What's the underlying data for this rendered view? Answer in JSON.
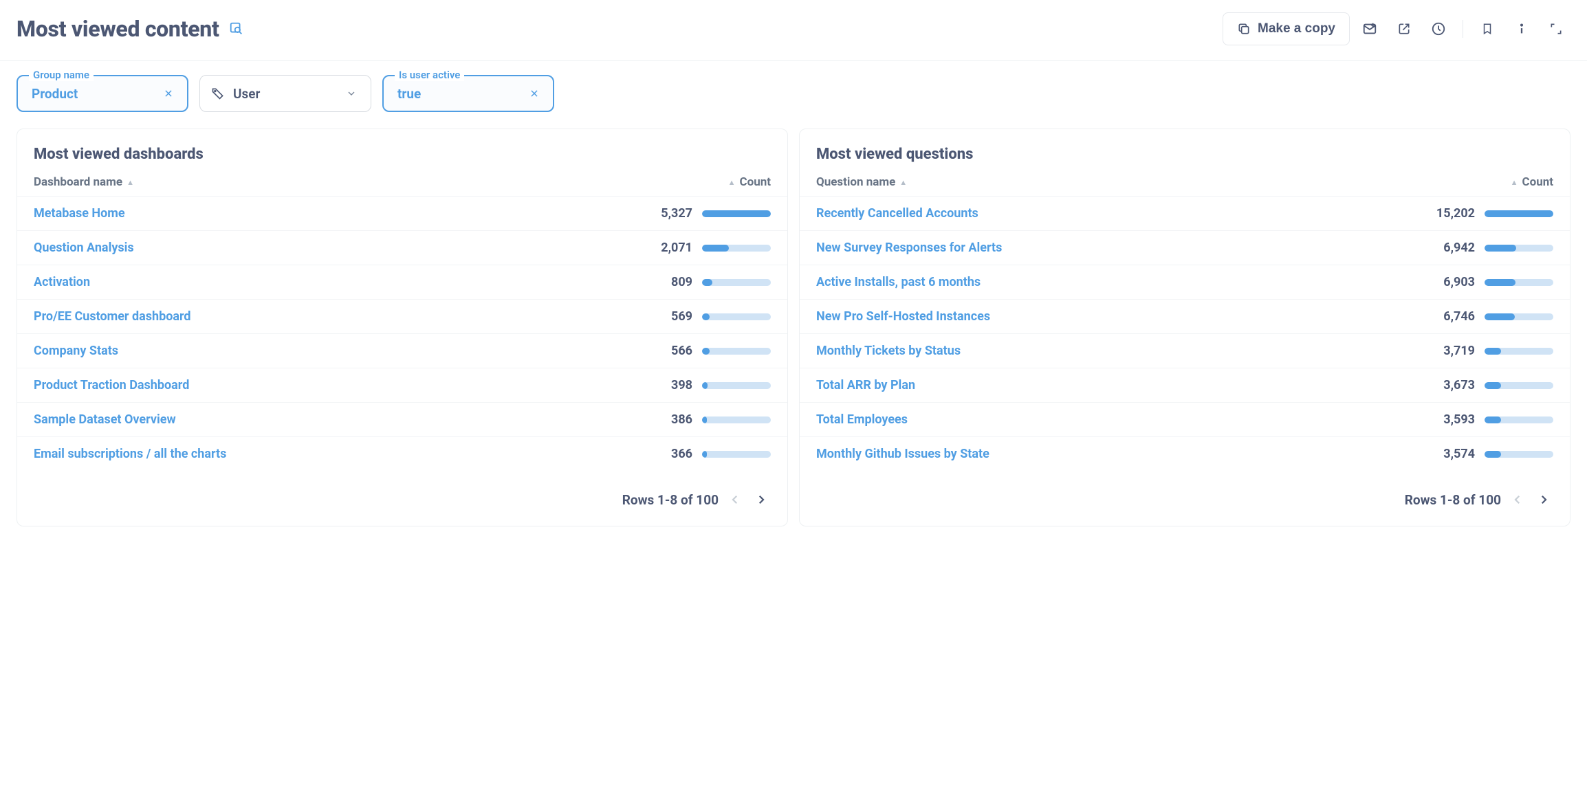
{
  "header": {
    "title": "Most viewed content",
    "copy_button": "Make a copy"
  },
  "filters": {
    "group_name": {
      "label": "Group name",
      "value": "Product"
    },
    "user": {
      "value": "User"
    },
    "is_active": {
      "label": "Is user active",
      "value": "true"
    }
  },
  "dashboards_panel": {
    "title": "Most viewed dashboards",
    "col_name": "Dashboard name",
    "col_count": "Count",
    "max": 5327,
    "rows": [
      {
        "name": "Metabase Home",
        "count": "5,327",
        "pct": 100
      },
      {
        "name": "Question Analysis",
        "count": "2,071",
        "pct": 39
      },
      {
        "name": "Activation",
        "count": "809",
        "pct": 15
      },
      {
        "name": "Pro/EE Customer dashboard",
        "count": "569",
        "pct": 11
      },
      {
        "name": "Company Stats",
        "count": "566",
        "pct": 11
      },
      {
        "name": "Product Traction Dashboard",
        "count": "398",
        "pct": 8
      },
      {
        "name": "Sample Dataset Overview",
        "count": "386",
        "pct": 7
      },
      {
        "name": "Email subscriptions / all the charts",
        "count": "366",
        "pct": 7
      }
    ],
    "footer": "Rows 1-8 of 100"
  },
  "questions_panel": {
    "title": "Most viewed questions",
    "col_name": "Question name",
    "col_count": "Count",
    "max": 15202,
    "rows": [
      {
        "name": "Recently Cancelled Accounts",
        "count": "15,202",
        "pct": 100
      },
      {
        "name": "New Survey Responses for Alerts",
        "count": "6,942",
        "pct": 46
      },
      {
        "name": "Active Installs, past 6 months",
        "count": "6,903",
        "pct": 45
      },
      {
        "name": "New Pro Self-Hosted Instances",
        "count": "6,746",
        "pct": 44
      },
      {
        "name": "Monthly Tickets by Status",
        "count": "3,719",
        "pct": 24
      },
      {
        "name": "Total ARR by Plan",
        "count": "3,673",
        "pct": 24
      },
      {
        "name": "Total Employees",
        "count": "3,593",
        "pct": 24
      },
      {
        "name": "Monthly Github Issues by State",
        "count": "3,574",
        "pct": 24
      }
    ],
    "footer": "Rows 1-8 of 100"
  }
}
